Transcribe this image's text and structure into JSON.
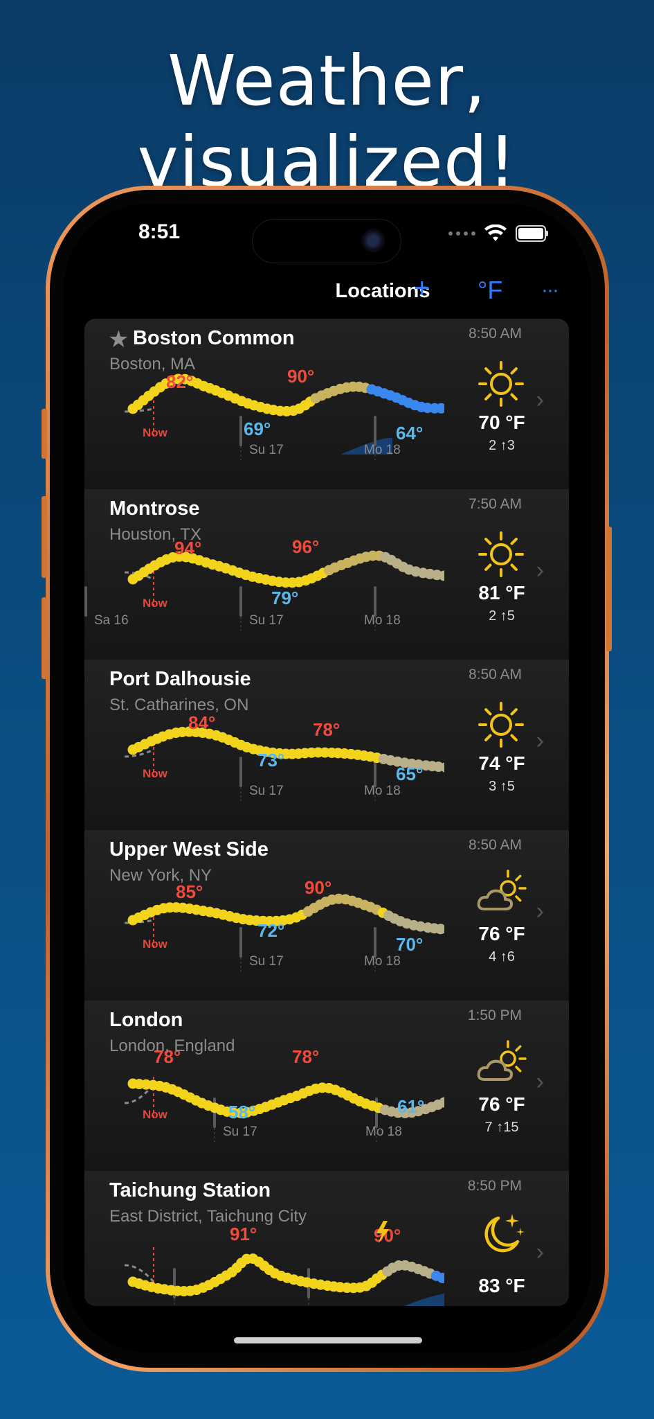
{
  "headline": "Weather, visualized!",
  "status_bar": {
    "time": "8:51"
  },
  "nav": {
    "title": "Locations",
    "add_label": "+",
    "unit_label": "°F",
    "more_label": "···"
  },
  "colors": {
    "accent": "#2f7cf6",
    "high": "#f04c3e",
    "low": "#5bb8ea",
    "now": "#e8463a"
  },
  "locations": [
    {
      "title": "Boston Common",
      "subtitle": "Boston, MA",
      "time": "8:50 AM",
      "icon": "sun-icon",
      "temp": "70 °F",
      "uv": "2 ↑3",
      "starred": true,
      "high1": "82°",
      "high2": "90°",
      "low1": "69°",
      "low2": "64°",
      "now": "Now",
      "day1": "Su  17",
      "day2": "Mo  18",
      "day0": ""
    },
    {
      "title": "Montrose",
      "subtitle": "Houston, TX",
      "time": "7:50 AM",
      "icon": "sun-icon",
      "temp": "81 °F",
      "uv": "2 ↑5",
      "starred": false,
      "high1": "94°",
      "high2": "96°",
      "low1": "79°",
      "low2": "",
      "now": "Now",
      "day1": "Su  17",
      "day2": "Mo  18",
      "day0": "Sa  16"
    },
    {
      "title": "Port Dalhousie",
      "subtitle": "St. Catharines, ON",
      "time": "8:50 AM",
      "icon": "sun-icon",
      "temp": "74 °F",
      "uv": "3 ↑5",
      "starred": false,
      "high1": "84°",
      "high2": "78°",
      "low1": "73°",
      "low2": "65°",
      "now": "Now",
      "day1": "Su  17",
      "day2": "Mo  18",
      "day0": ""
    },
    {
      "title": "Upper West Side",
      "subtitle": "New York, NY",
      "time": "8:50 AM",
      "icon": "partly-cloudy-icon",
      "temp": "76 °F",
      "uv": "4 ↑6",
      "starred": false,
      "high1": "85°",
      "high2": "90°",
      "low1": "72°",
      "low2": "70°",
      "now": "Now",
      "day1": "Su  17",
      "day2": "Mo  18",
      "day0": ""
    },
    {
      "title": "London",
      "subtitle": "London, England",
      "time": "1:50 PM",
      "icon": "partly-cloudy-icon",
      "temp": "76 °F",
      "uv": "7 ↑15",
      "starred": false,
      "high1": "78°",
      "high2": "78°",
      "low1": "58°",
      "low2": "61°",
      "now": "Now",
      "day1": "Su  17",
      "day2": "Mo  18",
      "day0": ""
    },
    {
      "title": "Taichung Station",
      "subtitle": "East District, Taichung City",
      "time": "8:50 PM",
      "icon": "moon-stars-icon",
      "temp": "83 °F",
      "uv": "",
      "starred": false,
      "high1": "91°",
      "high2": "90°",
      "low1": "",
      "low2": "",
      "now": "",
      "day1": "",
      "day2": "",
      "day0": ""
    }
  ]
}
